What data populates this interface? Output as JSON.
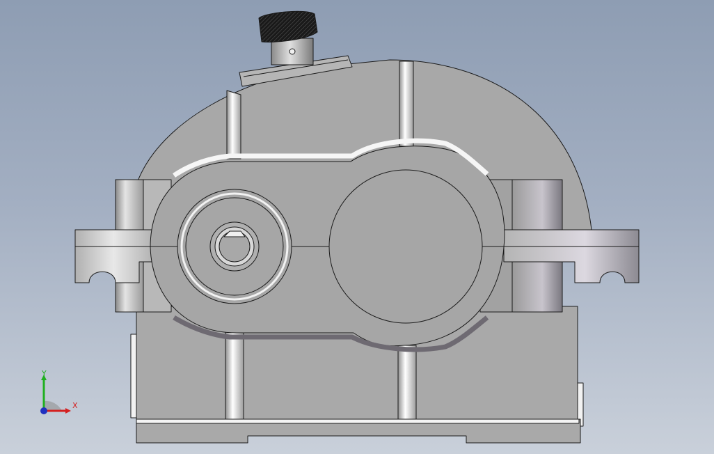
{
  "viewport": {
    "background_top": "#8e9db3",
    "background_bottom": "#c9d0da",
    "model_fill": "#a8a8a8",
    "edge_color": "#1a1a1a"
  },
  "triad": {
    "x_label": "X",
    "y_label": "Y",
    "x_color": "#d42020",
    "y_color": "#20b020",
    "z_color": "#2030c0"
  }
}
